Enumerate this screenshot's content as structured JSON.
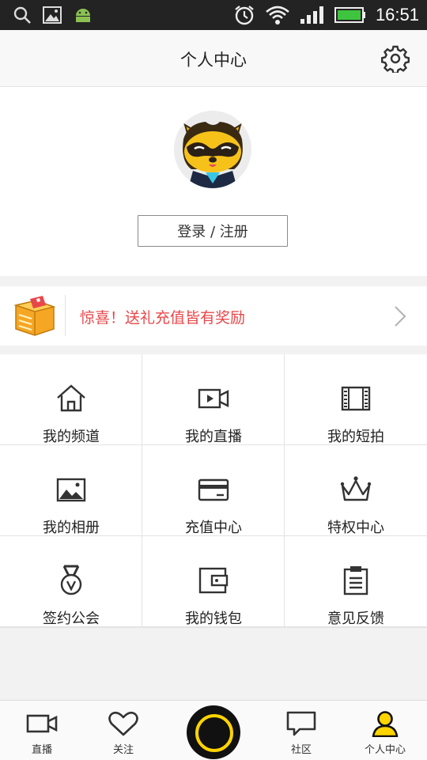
{
  "status_bar": {
    "time": "16:51"
  },
  "header": {
    "title": "个人中心"
  },
  "profile": {
    "login_label": "登录 / 注册"
  },
  "promo": {
    "text": "惊喜！送礼充值皆有奖励"
  },
  "grid": {
    "items": [
      {
        "label": "我的频道",
        "icon": "home-icon"
      },
      {
        "label": "我的直播",
        "icon": "video-camera-icon"
      },
      {
        "label": "我的短拍",
        "icon": "film-icon"
      },
      {
        "label": "我的相册",
        "icon": "image-icon"
      },
      {
        "label": "充值中心",
        "icon": "credit-card-icon"
      },
      {
        "label": "特权中心",
        "icon": "crown-icon"
      },
      {
        "label": "签约公会",
        "icon": "medal-icon"
      },
      {
        "label": "我的钱包",
        "icon": "wallet-icon"
      },
      {
        "label": "意见反馈",
        "icon": "clipboard-icon"
      }
    ]
  },
  "bottom_nav": {
    "items": [
      {
        "label": "直播",
        "icon": "video-camera-icon"
      },
      {
        "label": "关注",
        "icon": "heart-icon"
      },
      {
        "label": "社区",
        "icon": "chat-bubble-icon"
      },
      {
        "label": "个人中心",
        "icon": "person-icon",
        "active": true
      }
    ]
  },
  "colors": {
    "accent": "#ffd400",
    "promo_text": "#e8474a",
    "status_bar": "#232323"
  }
}
